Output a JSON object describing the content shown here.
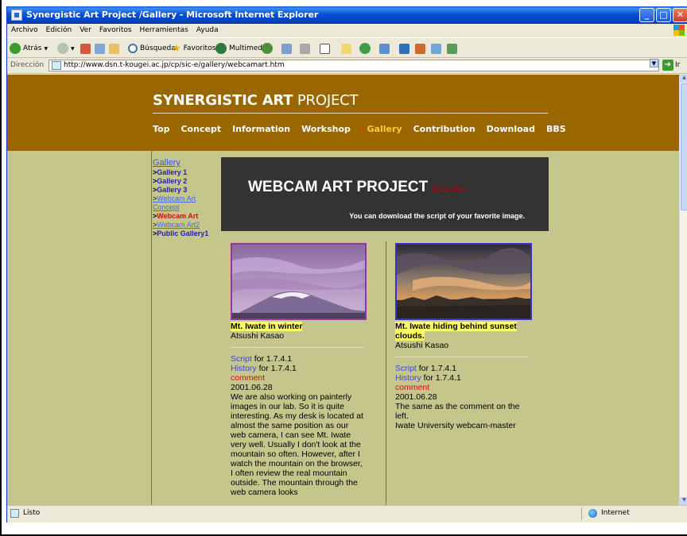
{
  "window": {
    "title": "Synergistic Art Project /Gallery - Microsoft Internet Explorer",
    "controls": {
      "minimize": "_",
      "maximize": "□",
      "close": "✕"
    }
  },
  "menu": [
    "Archivo",
    "Edición",
    "Ver",
    "Favoritos",
    "Herramientas",
    "Ayuda"
  ],
  "toolbar": {
    "back": "Atrás",
    "search": "Búsqueda",
    "favorites": "Favoritos",
    "media": "Multimedia"
  },
  "address": {
    "label": "Dirección",
    "url": "http://www.dsn.t-kougei.ac.jp/cp/sic-e/gallery/webcamart.htm",
    "go": "Ir"
  },
  "site": {
    "title_bold": "SYNERGISTIC ART",
    "title_light": "PROJECT",
    "nav": [
      "Top",
      "Concept",
      "Information",
      "Workshop",
      "Gallery",
      "Contribution",
      "Download",
      "BBS"
    ],
    "active_nav": "Gallery"
  },
  "sidebar": {
    "title": "Gallery",
    "items": [
      {
        "label": "Gallery 1"
      },
      {
        "label": "Gallery 2"
      },
      {
        "label": "Gallery 3"
      },
      {
        "label": "Webcam Art Concept"
      },
      {
        "label": "Webcam Art"
      },
      {
        "label": "Webcam Art2"
      },
      {
        "label": "Public Gallery1"
      }
    ]
  },
  "banner": {
    "title": "WEBCAM ART PROJECT",
    "year": "2001-2002",
    "subtitle": "You can download the script of your favorite image."
  },
  "cards": [
    {
      "title": "Mt. Iwate in winter",
      "author": "Atsushi Kasao",
      "script_link": "Script",
      "script_version": " for 1.7.4.1",
      "history_link": "History",
      "history_version": " for 1.7.4.1",
      "comment_label": "comment",
      "date": "2001.06.28",
      "comment_text": "We are also working on painterly images in our lab. So it is quite interesting. As my desk is located at almost the same position as our web camera, I can see Mt. Iwate very well. Usually I don't look at the mountain so often. However, after I watch the mountain on the browser, I often review the real mountain outside. The mountain through the web camera looks"
    },
    {
      "title": "Mt. Iwate hiding behind sunset clouds.",
      "author": "Atsushi Kasao",
      "script_link": "Script",
      "script_version": " for 1.7.4.1",
      "history_link": "History",
      "history_version": " for 1.7.4.1",
      "comment_label": "comment",
      "date": "2001.06.28",
      "comment_text": "The same as the comment on the left.",
      "affiliation": "Iwate University webcam-master"
    }
  ],
  "status": {
    "text": "Listo",
    "zone": "Internet"
  },
  "colors": {
    "header_bg": "#996600",
    "page_bg": "#c4c68c",
    "banner_bg": "#333333",
    "active_nav": "#ffcc33",
    "highlight": "#ffff66"
  }
}
